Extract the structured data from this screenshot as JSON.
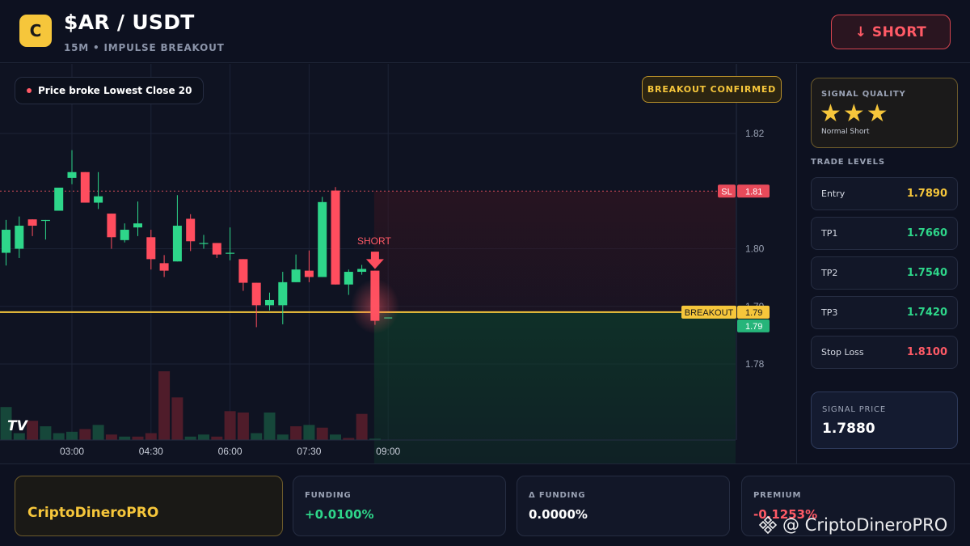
{
  "header": {
    "logo_letter": "C",
    "pair": "$AR / USDT",
    "subline": "15M • IMPULSE BREAKOUT",
    "short_button": "↓ SHORT"
  },
  "chart": {
    "legend_text": "Price broke Lowest Close 20",
    "badge": "BREAKOUT CONFIRMED",
    "short_marker": "SHORT",
    "sl_tag": "SL",
    "sl_value": "1.81",
    "breakout_tag": "BREAKOUT",
    "breakout_value": "1.79",
    "last_value": "1.79",
    "logo_mark": "TV"
  },
  "chart_data": {
    "type": "candlestick",
    "x_ticks": [
      "03:00",
      "04:30",
      "06:00",
      "07:30",
      "09:00"
    ],
    "y_ticks": [
      "1.82",
      "1.80",
      "1.79",
      "1.78"
    ],
    "ylim": [
      1.7725,
      1.8233
    ],
    "levels": {
      "stop_loss": 1.81,
      "breakout": 1.789,
      "entry": 1.789
    },
    "candles": [
      {
        "o": 1.7993,
        "h": 1.805,
        "l": 1.7971,
        "c": 1.8033
      },
      {
        "o": 1.8,
        "h": 1.8056,
        "l": 1.7984,
        "c": 1.804
      },
      {
        "o": 1.8051,
        "h": 1.8051,
        "l": 1.8022,
        "c": 1.804
      },
      {
        "o": 1.805,
        "h": 1.805,
        "l": 1.8016,
        "c": 1.805
      },
      {
        "o": 1.8066,
        "h": 1.8106,
        "l": 1.8066,
        "c": 1.8106
      },
      {
        "o": 1.8123,
        "h": 1.8171,
        "l": 1.8112,
        "c": 1.8133
      },
      {
        "o": 1.8133,
        "h": 1.8133,
        "l": 1.808,
        "c": 1.808
      },
      {
        "o": 1.808,
        "h": 1.8133,
        "l": 1.8069,
        "c": 1.8091
      },
      {
        "o": 1.8061,
        "h": 1.8061,
        "l": 1.8,
        "c": 1.802
      },
      {
        "o": 1.8015,
        "h": 1.8044,
        "l": 1.8011,
        "c": 1.8033
      },
      {
        "o": 1.8037,
        "h": 1.8082,
        "l": 1.8022,
        "c": 1.8044
      },
      {
        "o": 1.802,
        "h": 1.8033,
        "l": 1.7964,
        "c": 1.7982
      },
      {
        "o": 1.7975,
        "h": 1.7989,
        "l": 1.7951,
        "c": 1.7962
      },
      {
        "o": 1.7978,
        "h": 1.8093,
        "l": 1.7978,
        "c": 1.804
      },
      {
        "o": 1.8052,
        "h": 1.806,
        "l": 1.7996,
        "c": 1.8013
      },
      {
        "o": 1.801,
        "h": 1.8024,
        "l": 1.8,
        "c": 1.801
      },
      {
        "o": 1.801,
        "h": 1.801,
        "l": 1.7984,
        "c": 1.799
      },
      {
        "o": 1.7993,
        "h": 1.8037,
        "l": 1.798,
        "c": 1.7993
      },
      {
        "o": 1.7982,
        "h": 1.7982,
        "l": 1.7927,
        "c": 1.7941
      },
      {
        "o": 1.7941,
        "h": 1.7941,
        "l": 1.7864,
        "c": 1.7902
      },
      {
        "o": 1.7902,
        "h": 1.7924,
        "l": 1.7893,
        "c": 1.7911
      },
      {
        "o": 1.7902,
        "h": 1.796,
        "l": 1.7869,
        "c": 1.7942
      },
      {
        "o": 1.7942,
        "h": 1.799,
        "l": 1.7942,
        "c": 1.7964
      },
      {
        "o": 1.7962,
        "h": 1.7997,
        "l": 1.7942,
        "c": 1.7951
      },
      {
        "o": 1.7951,
        "h": 1.809,
        "l": 1.7951,
        "c": 1.8081
      },
      {
        "o": 1.8101,
        "h": 1.8107,
        "l": 1.7938,
        "c": 1.7938
      },
      {
        "o": 1.7938,
        "h": 1.7964,
        "l": 1.792,
        "c": 1.796
      },
      {
        "o": 1.796,
        "h": 1.7972,
        "l": 1.7955,
        "c": 1.7965
      },
      {
        "o": 1.7962,
        "h": 1.7962,
        "l": 1.7868,
        "c": 1.7875
      },
      {
        "o": 1.788,
        "h": 1.788,
        "l": 1.788,
        "c": 1.788
      }
    ],
    "volume": [
      0.48,
      0.1,
      0.28,
      0.2,
      0.1,
      0.12,
      0.16,
      0.22,
      0.08,
      0.05,
      0.05,
      0.1,
      1.0,
      0.62,
      0.05,
      0.08,
      0.05,
      0.42,
      0.4,
      0.1,
      0.4,
      0.08,
      0.2,
      0.22,
      0.18,
      0.08,
      0.03,
      0.38,
      0.02
    ],
    "volume_up": [
      true,
      true,
      false,
      true,
      true,
      true,
      false,
      true,
      false,
      true,
      false,
      false,
      false,
      false,
      true,
      true,
      false,
      false,
      false,
      true,
      true,
      true,
      false,
      true,
      false,
      true,
      false,
      false,
      true
    ]
  },
  "sidebar": {
    "quality_title": "SIGNAL QUALITY",
    "stars": "★★★",
    "quality_sub": "Normal Short",
    "levels_title": "TRADE LEVELS",
    "levels": [
      {
        "label": "Entry",
        "value": "1.7890",
        "color": "#f6c63b"
      },
      {
        "label": "TP1",
        "value": "1.7660",
        "color": "#2ed68a"
      },
      {
        "label": "TP2",
        "value": "1.7540",
        "color": "#2ed68a"
      },
      {
        "label": "TP3",
        "value": "1.7420",
        "color": "#2ed68a"
      },
      {
        "label": "Stop Loss",
        "value": "1.8100",
        "color": "#ff5a66"
      }
    ],
    "signal_price_label": "SIGNAL PRICE",
    "signal_price": "1.7880"
  },
  "footer": {
    "brand": "CriptoDineroPRO",
    "stats": [
      {
        "label": "FUNDING",
        "value": "+0.0100%",
        "color": "#2ed68a"
      },
      {
        "label": "Δ FUNDING",
        "value": "0.0000%",
        "color": "#ffffff"
      },
      {
        "label": "PREMIUM",
        "value": "-0.1253%",
        "color": "#ff5a66"
      }
    ],
    "watermark": "@ CriptoDineroPRO"
  }
}
